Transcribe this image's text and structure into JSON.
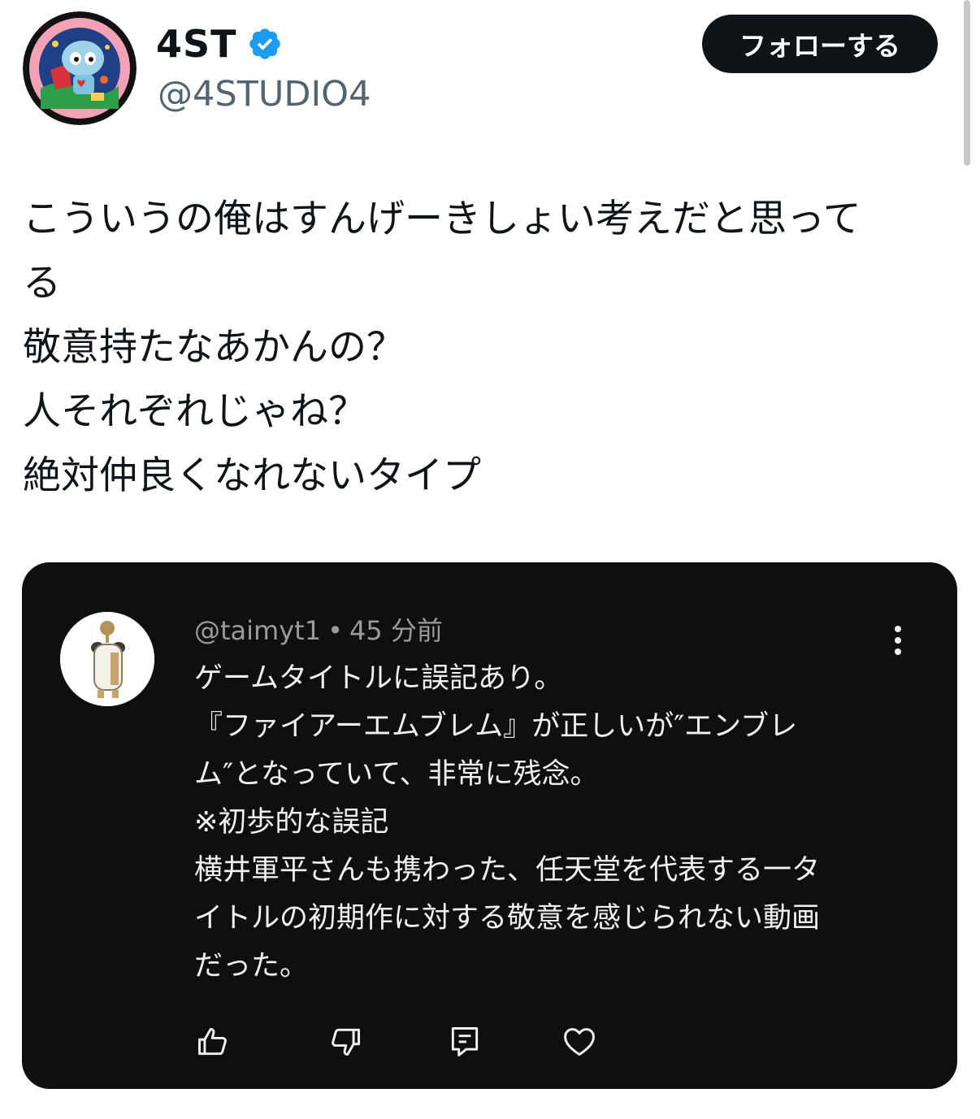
{
  "profile": {
    "display_name": "4ST",
    "handle": "@4STUDIO4",
    "verified_icon": "verified-badge-icon",
    "avatar_icon": "robot-avatar-icon"
  },
  "follow_button": {
    "label": "フォローする"
  },
  "tweet": {
    "lines": [
      "こういうの俺はすんげーきしょい考えだと思って",
      "る",
      "敬意持たなあかんの？",
      "人それぞれじゃね？",
      "絶対仲良くなれないタイプ"
    ]
  },
  "embedded_comment": {
    "author": "@taimyt1",
    "separator": "•",
    "time": "45 分前",
    "avatar_icon": "mascot-avatar-icon",
    "lines": [
      "ゲームタイトルに誤記あり。",
      "『ファイアーエムブレム』が正しいが″エンブレ",
      "ム″となっていて、非常に残念。",
      "※初歩的な誤記",
      "横井軍平さんも携わった、任天堂を代表する一タ",
      "イトルの初期作に対する敬意を感じられない動画",
      "だった。"
    ],
    "actions": [
      "thumbs-up-icon",
      "thumbs-down-icon",
      "reply-icon",
      "heart-icon"
    ],
    "more_icon": "more-vertical-icon"
  },
  "colors": {
    "text_primary": "#0f1419",
    "text_secondary": "#536471",
    "verified_blue": "#1d9bf0",
    "card_background": "#0f0f0f",
    "card_text": "#f1f1f1",
    "card_meta": "#9a9a9a"
  }
}
